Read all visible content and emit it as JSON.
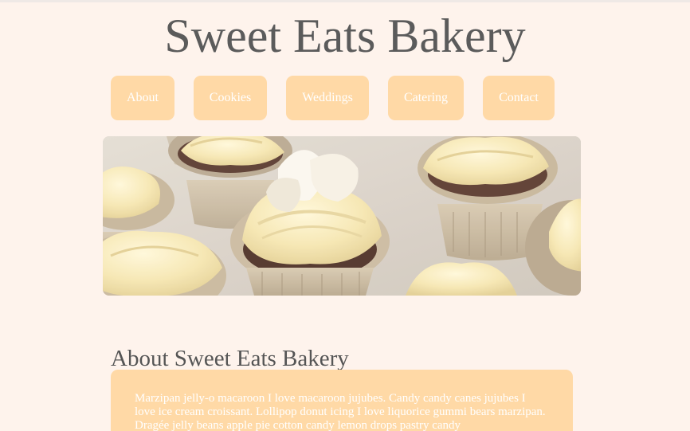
{
  "header": {
    "title": "Sweet Eats Bakery"
  },
  "nav": {
    "items": [
      {
        "label": "About"
      },
      {
        "label": "Cookies"
      },
      {
        "label": "Weddings"
      },
      {
        "label": "Catering"
      },
      {
        "label": "Contact"
      }
    ]
  },
  "hero": {
    "image_subject": "cupcakes-with-cream-frosting"
  },
  "about": {
    "heading": "About Sweet Eats Bakery",
    "body": "Marzipan jelly-o macaroon I love macaroon jujubes. Candy candy canes jujubes I love ice cream croissant. Lollipop donut icing I love liquorice gummi bears marzipan. Dragée jelly beans apple pie cotton candy lemon drops pastry candy"
  },
  "colors": {
    "background": "#fef3ec",
    "button": "#ffd9a6",
    "button_text": "#ffffff",
    "title_text": "#5b5b5b"
  }
}
